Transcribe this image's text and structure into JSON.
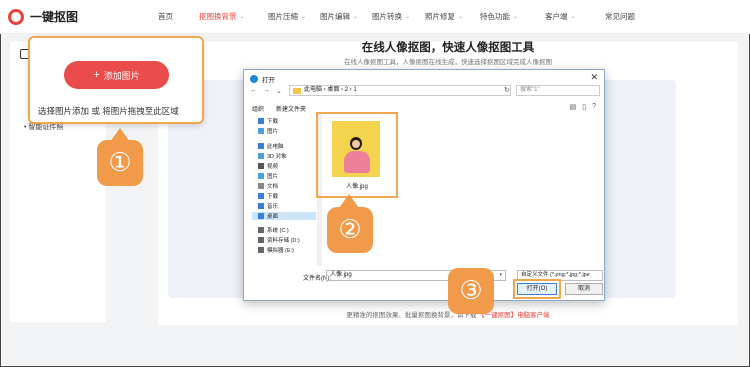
{
  "header": {
    "logo_text": "一键抠图",
    "nav": [
      {
        "label": "首页",
        "chevron": false,
        "active": false
      },
      {
        "label": "抠图换背景",
        "chevron": true,
        "active": true
      },
      {
        "label": "图片压缩",
        "chevron": true,
        "active": false
      },
      {
        "label": "图片编辑",
        "chevron": true,
        "active": false
      },
      {
        "label": "图片转换",
        "chevron": true,
        "active": false
      },
      {
        "label": "照片修复",
        "chevron": true,
        "active": false
      },
      {
        "label": "特色功能",
        "chevron": true,
        "active": false
      },
      {
        "label": "客户端",
        "chevron": true,
        "active": false
      },
      {
        "label": "常见问题",
        "chevron": false,
        "active": false
      }
    ]
  },
  "main": {
    "title": "在线人像抠图，快速人像抠图工具",
    "subtitle": "在线人像抠图工具，人像抠图在线生成，快速选择抠图区域完成人像抠图",
    "footer_prefix": "更精准的抠图效果、批量抠图换背景，请下载",
    "footer_link": "【一键抠图】电脑客户端"
  },
  "sidebar": {
    "bullet_1": "•",
    "bullet_2": "•",
    "bullet_3": "智能证件照"
  },
  "popup": {
    "add_button_label": "添加图片",
    "hint": "选择图片添加 或 将图片拖拽至此区域"
  },
  "steps": [
    "①",
    "②",
    "③"
  ],
  "dialog": {
    "title": "打开",
    "close": "✕",
    "path": [
      "此电脑",
      "桌面",
      "2",
      "1"
    ],
    "search_placeholder": "搜索\"1\"",
    "toolbar": {
      "organize": "组织",
      "new_folder": "新建文件夹"
    },
    "tree": [
      {
        "label": "下载",
        "icon": "download-icon",
        "color": "#3a7fd5"
      },
      {
        "label": "图片",
        "icon": "picture-icon",
        "color": "#4aa0d8"
      },
      {
        "label": "此电脑",
        "icon": "computer-icon",
        "color": "#3a7fd5"
      },
      {
        "label": "3D 对象",
        "icon": "cube-icon",
        "color": "#4aa0d8"
      },
      {
        "label": "视频",
        "icon": "video-icon",
        "color": "#555555"
      },
      {
        "label": "图片",
        "icon": "picture-icon",
        "color": "#4aa0d8"
      },
      {
        "label": "文档",
        "icon": "document-icon",
        "color": "#888888"
      },
      {
        "label": "下载",
        "icon": "download-icon",
        "color": "#3a7fd5"
      },
      {
        "label": "音乐",
        "icon": "music-icon",
        "color": "#3a7fd5"
      },
      {
        "label": "桌面",
        "icon": "desktop-icon",
        "color": "#3a7fd5",
        "selected": true
      },
      {
        "label": "系统 (C:)",
        "icon": "drive-icon",
        "color": "#666666"
      },
      {
        "label": "资料存储 (D:)",
        "icon": "drive-icon",
        "color": "#666666"
      },
      {
        "label": "模拟器 (E:)",
        "icon": "drive-icon",
        "color": "#666666"
      }
    ],
    "file": {
      "name": "人像.jpg"
    },
    "filename_label": "文件名(N):",
    "filename_value": "人像.jpg",
    "filetype_value": "自定义文件 (*.png;*.jpg;*.jpe",
    "open_button": "打开(O)",
    "cancel_button": "取消"
  },
  "colors": {
    "accent": "#e8423a",
    "step_badge": "#f19a4a",
    "highlight": "#f0a850"
  }
}
